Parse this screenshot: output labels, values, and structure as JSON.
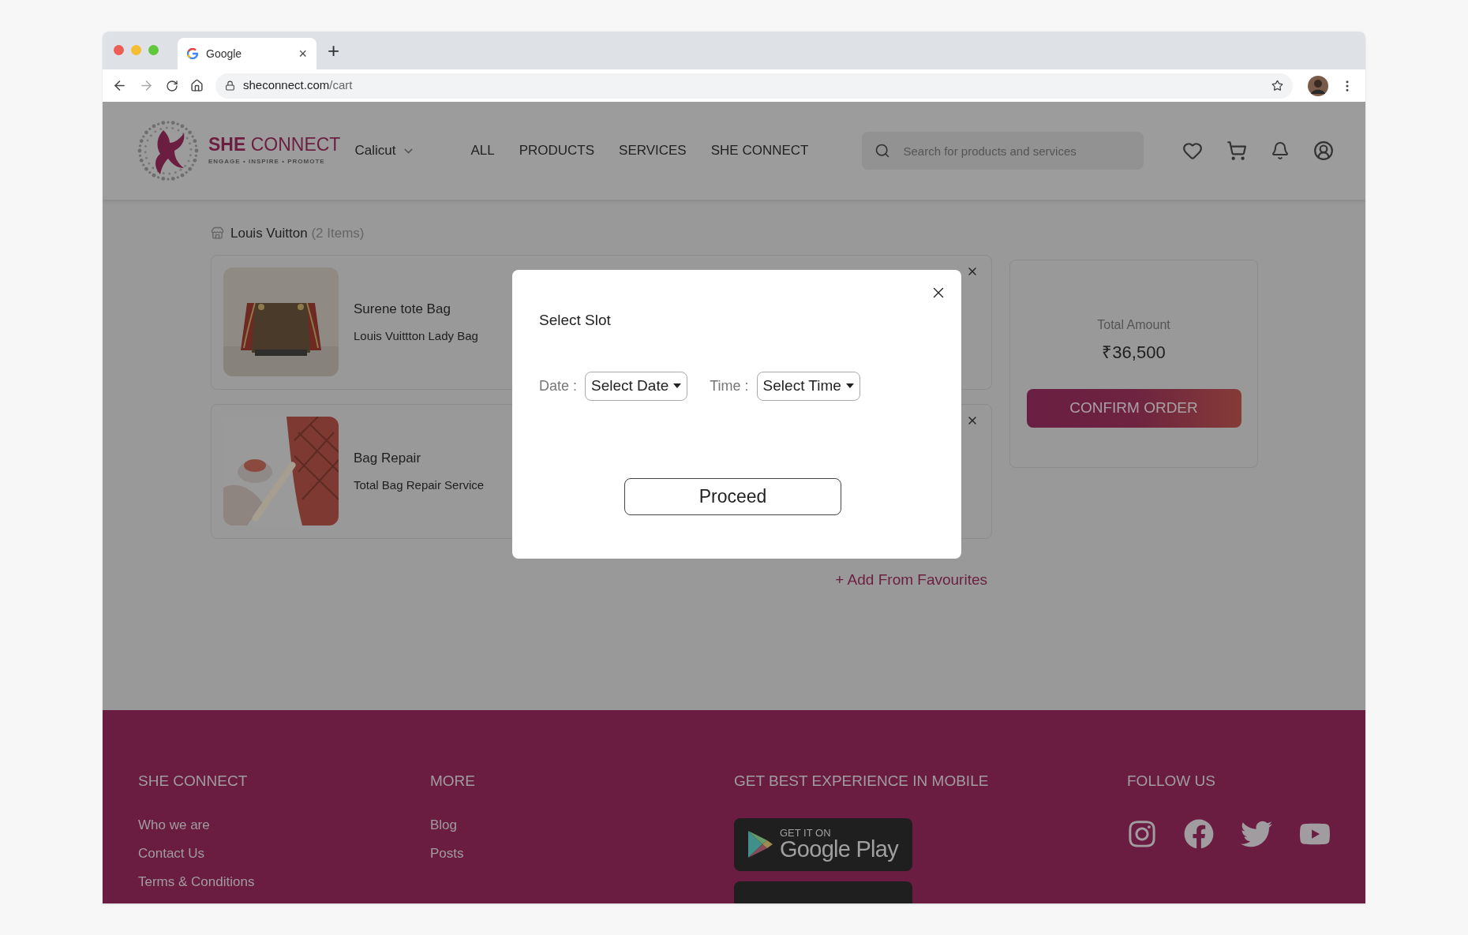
{
  "browser": {
    "tab": {
      "title": "Google",
      "close": "×"
    },
    "new_tab": "+",
    "url": {
      "host": "sheconnect.com",
      "path": "/cart"
    }
  },
  "header": {
    "brand": {
      "name_bold": "SHE",
      "name_rest": "CONNECT",
      "tagline": "ENGAGE • INSPIRE • PROMOTE"
    },
    "location": "Calicut",
    "nav": [
      {
        "label": "ALL"
      },
      {
        "label": "PRODUCTS"
      },
      {
        "label": "SERVICES"
      },
      {
        "label": "SHE CONNECT"
      }
    ],
    "search": {
      "placeholder": "Search for products and services"
    }
  },
  "cart": {
    "store": {
      "name": "Louis Vuitton",
      "count": "(2 Items)"
    },
    "items": [
      {
        "kind": "product",
        "title": "Surene tote Bag",
        "subtitle": "Louis Vuittton Lady Bag"
      },
      {
        "kind": "service",
        "title": "Bag Repair",
        "subtitle": "Total Bag Repair Service"
      }
    ],
    "add_link": "+ Add From Favourites"
  },
  "summary": {
    "label": "Total Amount",
    "amount": "₹36,500",
    "button": "CONFIRM ORDER"
  },
  "modal": {
    "title": "Select Slot",
    "fields": [
      {
        "label": "Date :",
        "value": "Select Date"
      },
      {
        "label": "Time :",
        "value": "Select Time"
      }
    ],
    "button": "Proceed"
  },
  "footer": {
    "columns": [
      {
        "kind": "links",
        "heading": "SHE CONNECT",
        "links": [
          "Who we are",
          "Contact Us",
          "Terms & Conditions"
        ]
      },
      {
        "kind": "links",
        "heading": "MORE",
        "links": [
          "Blog",
          "Posts"
        ]
      },
      {
        "kind": "badges",
        "heading": "GET BEST EXPERIENCE IN MOBILE",
        "badges": [
          {
            "kind": "google-play",
            "small": "GET IT ON",
            "big": "Google Play"
          },
          {
            "kind": "cut-off"
          }
        ]
      },
      {
        "kind": "social",
        "heading": "FOLLOW US"
      }
    ]
  }
}
